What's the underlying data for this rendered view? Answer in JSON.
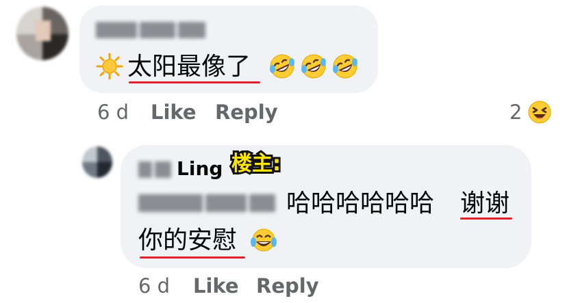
{
  "comment1": {
    "author_blurred": true,
    "text": "太阳最像了",
    "leading_emoji": "sun",
    "trailing_emojis": [
      "rolling-on-floor-laughing",
      "rolling-on-floor-laughing",
      "rolling-on-floor-laughing"
    ],
    "time": "6 d",
    "like_label": "Like",
    "reply_label": "Reply",
    "reaction_count": "2",
    "reaction_emoji": "laughing-squinting"
  },
  "reply1": {
    "author_suffix": "Ling",
    "owner_tag": "楼主:",
    "mention_blurred": true,
    "text_line1": "哈哈哈哈哈哈",
    "text_line1_end": "谢谢",
    "text_line2": "你的安慰",
    "trailing_emoji": "tears-of-joy",
    "time": "6 d",
    "like_label": "Like",
    "reply_label": "Reply"
  },
  "colors": {
    "bubble_bg": "#f0f2f5",
    "underline": "#e0202a",
    "owner_tag_fill": "#ffe600",
    "meta_text": "#65676b"
  }
}
